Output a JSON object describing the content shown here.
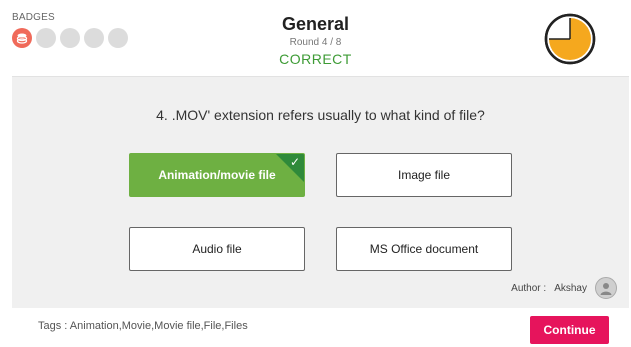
{
  "header": {
    "badges_label": "BADGES",
    "badges": [
      {
        "state": "earned",
        "icon": "stack-icon"
      },
      {
        "state": "locked"
      },
      {
        "state": "locked"
      },
      {
        "state": "locked"
      },
      {
        "state": "locked"
      }
    ],
    "title": "General",
    "round": "Round 4 / 8",
    "result": "CORRECT",
    "timer_icon": "clock-icon"
  },
  "question": {
    "text": "4. .MOV' extension refers usually to what kind of file?",
    "answers": [
      {
        "label": "Animation/movie file",
        "correct": true
      },
      {
        "label": "Image file",
        "correct": false
      },
      {
        "label": "Audio file",
        "correct": false
      },
      {
        "label": "MS Office document",
        "correct": false
      }
    ]
  },
  "author": {
    "label": "Author :",
    "name": "Akshay"
  },
  "footer": {
    "tags": "Tags : Animation,Movie,Movie file,File,Files",
    "continue_label": "Continue"
  },
  "colors": {
    "correct_green": "#6eb042",
    "result_green": "#3d9b35",
    "continue_pink": "#e6145c",
    "timer_orange": "#f5a81e"
  }
}
